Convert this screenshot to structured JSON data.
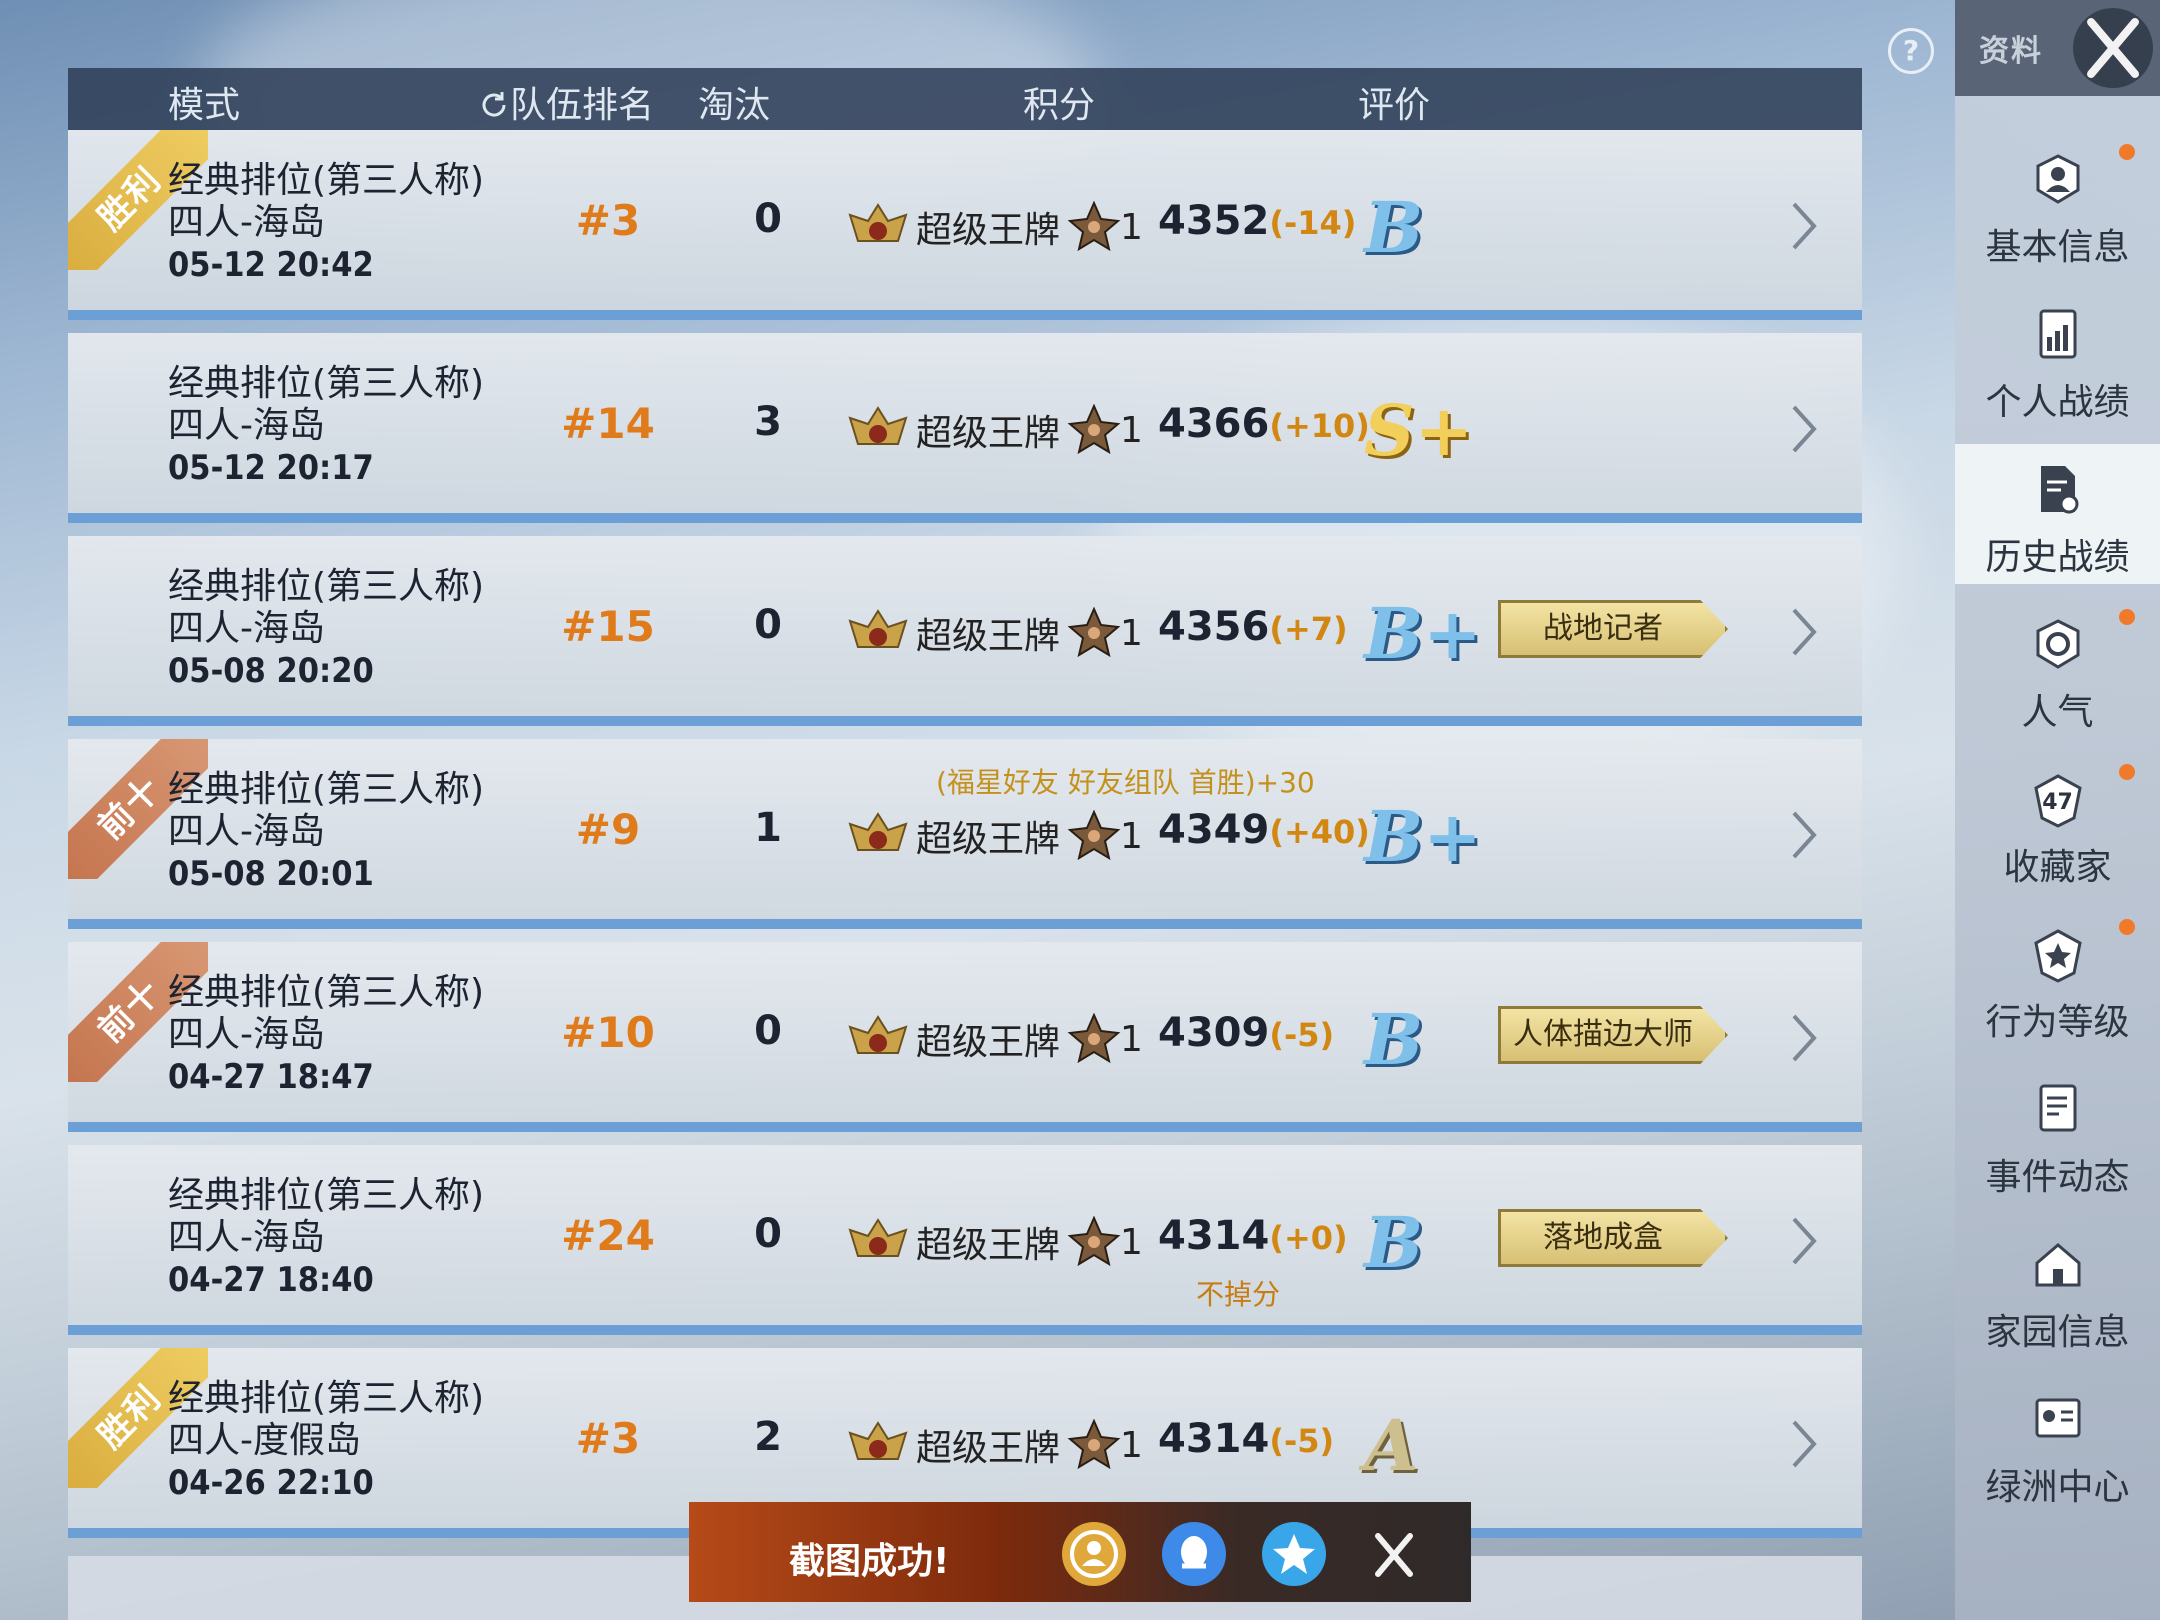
{
  "header": {
    "mode": "模式",
    "team_rank": "队伍排名",
    "elims": "淘汰",
    "score": "积分",
    "rating": "评价"
  },
  "help": "?",
  "rows": [
    {
      "ribbon": "胜利",
      "ribbon_type": "win",
      "mode": "经典排位(第三人称)",
      "map": "四人-海岛",
      "date": "05-12 20:42",
      "rank": "#3",
      "elims": "0",
      "tier": "超级王牌",
      "stars": "1",
      "score": "4352",
      "delta": "(-14)",
      "grade": "B",
      "grade_color": "blue",
      "badge": "",
      "bonus": "",
      "note": ""
    },
    {
      "ribbon": "",
      "ribbon_type": "",
      "mode": "经典排位(第三人称)",
      "map": "四人-海岛",
      "date": "05-12 20:17",
      "rank": "#14",
      "elims": "3",
      "tier": "超级王牌",
      "stars": "1",
      "score": "4366",
      "delta": "(+10)",
      "grade": "S+",
      "grade_color": "gold",
      "badge": "",
      "bonus": "",
      "note": ""
    },
    {
      "ribbon": "",
      "ribbon_type": "",
      "mode": "经典排位(第三人称)",
      "map": "四人-海岛",
      "date": "05-08 20:20",
      "rank": "#15",
      "elims": "0",
      "tier": "超级王牌",
      "stars": "1",
      "score": "4356",
      "delta": "(+7)",
      "grade": "B+",
      "grade_color": "blue",
      "badge": "战地记者",
      "bonus": "",
      "note": ""
    },
    {
      "ribbon": "前十",
      "ribbon_type": "top10",
      "mode": "经典排位(第三人称)",
      "map": "四人-海岛",
      "date": "05-08 20:01",
      "rank": "#9",
      "elims": "1",
      "tier": "超级王牌",
      "stars": "1",
      "score": "4349",
      "delta": "(+40)",
      "grade": "B+",
      "grade_color": "blue",
      "badge": "",
      "bonus": "(福星好友 好友组队 首胜)+30",
      "note": ""
    },
    {
      "ribbon": "前十",
      "ribbon_type": "top10",
      "mode": "经典排位(第三人称)",
      "map": "四人-海岛",
      "date": "04-27 18:47",
      "rank": "#10",
      "elims": "0",
      "tier": "超级王牌",
      "stars": "1",
      "score": "4309",
      "delta": "(-5)",
      "grade": "B",
      "grade_color": "blue",
      "badge": "人体描边大师",
      "bonus": "",
      "note": ""
    },
    {
      "ribbon": "",
      "ribbon_type": "",
      "mode": "经典排位(第三人称)",
      "map": "四人-海岛",
      "date": "04-27 18:40",
      "rank": "#24",
      "elims": "0",
      "tier": "超级王牌",
      "stars": "1",
      "score": "4314",
      "delta": "(+0)",
      "grade": "B",
      "grade_color": "blue",
      "badge": "落地成盒",
      "bonus": "",
      "note": "不掉分"
    },
    {
      "ribbon": "胜利",
      "ribbon_type": "win",
      "mode": "经典排位(第三人称)",
      "map": "四人-度假岛",
      "date": "04-26 22:10",
      "rank": "#3",
      "elims": "2",
      "tier": "超级王牌",
      "stars": "1",
      "score": "4314",
      "delta": "(-5)",
      "grade": "A",
      "grade_color": "gray",
      "badge": "",
      "bonus": "",
      "note": ""
    }
  ],
  "sidebar": {
    "title": "资料",
    "items": [
      {
        "label": "基本信息",
        "icon": "profile-icon",
        "dot": true
      },
      {
        "label": "个人战绩",
        "icon": "stats-icon",
        "dot": false
      },
      {
        "label": "历史战绩",
        "icon": "history-icon",
        "dot": false,
        "active": true
      },
      {
        "label": "人气",
        "icon": "popularity-icon",
        "dot": true
      },
      {
        "label": "收藏家",
        "icon": "collector-icon",
        "dot": true,
        "level": "47"
      },
      {
        "label": "行为等级",
        "icon": "behavior-icon",
        "dot": true
      },
      {
        "label": "事件动态",
        "icon": "events-icon",
        "dot": false
      },
      {
        "label": "家园信息",
        "icon": "home-icon",
        "dot": false
      },
      {
        "label": "绿洲中心",
        "icon": "oasis-icon",
        "dot": false
      }
    ]
  },
  "toast": {
    "text": "截图成功!",
    "share_icons": [
      "friends-share-icon",
      "qq-share-icon",
      "qzone-share-icon",
      "close-icon"
    ]
  },
  "colors": {
    "rank": "#e07b1c",
    "delta": "#d28712",
    "row_border": "#6c9fd6",
    "dot": "#f07a2a"
  }
}
